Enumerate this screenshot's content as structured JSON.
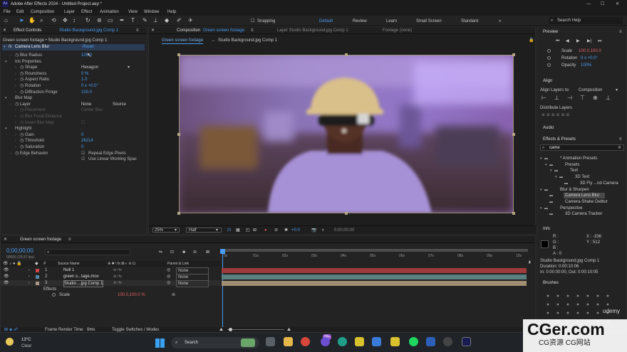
{
  "window": {
    "title": "Adobe After Effects 2024 - Untitled Project.aep *"
  },
  "menu": [
    "File",
    "Edit",
    "Composition",
    "Layer",
    "Effect",
    "Animation",
    "View",
    "Window",
    "Help"
  ],
  "toolbar": {
    "snapping": "Snapping",
    "workspaces": [
      "Default",
      "Review",
      "Learn",
      "Small Screen",
      "Standard"
    ],
    "search": "Search Help"
  },
  "effect_controls": {
    "tab": "Effect Controls",
    "tab_layer": "Studio Background.jpg Comp 1",
    "path": "Green screen footage • Studio Background.jpg Comp 1",
    "effect_name": "Camera Lens Blur",
    "reset": "Reset",
    "props": [
      {
        "name": "Blur Radius",
        "value": "105.0",
        "indent": 1
      },
      {
        "name": "Iris Properties",
        "value": "",
        "indent": 0
      },
      {
        "name": "Shape",
        "value": "Hexagon",
        "indent": 2
      },
      {
        "name": "Roundness",
        "value": "0 %",
        "indent": 2
      },
      {
        "name": "Aspect Ratio",
        "value": "1.0",
        "indent": 2
      },
      {
        "name": "Rotation",
        "value": "0 x +0.0°",
        "indent": 2
      },
      {
        "name": "Diffraction Fringe",
        "value": "100.0",
        "indent": 2
      },
      {
        "name": "Blur Map",
        "value": "",
        "indent": 0
      },
      {
        "name": "Layer",
        "value": "None",
        "value2": "Source",
        "indent": 1
      },
      {
        "name": "Placement",
        "value": "Center Blur",
        "indent": 2,
        "dim": true
      },
      {
        "name": "Blur Focal Distance",
        "value": "",
        "indent": 2,
        "dim": true
      },
      {
        "name": "Invert Blur Map",
        "value": "",
        "indent": 2,
        "dim": true
      },
      {
        "name": "Highlight",
        "value": "",
        "indent": 0
      },
      {
        "name": "Gain",
        "value": "0",
        "indent": 2
      },
      {
        "name": "Threshold",
        "value": "26214",
        "indent": 2
      },
      {
        "name": "Saturation",
        "value": "0",
        "indent": 2
      },
      {
        "name": "Edge Behavior",
        "value": "Repeat Edge Pixels",
        "indent": 1
      },
      {
        "name": "",
        "value": "Use Linear Working Spac",
        "indent": 1
      }
    ]
  },
  "composition": {
    "tab": "Composition",
    "tab_name": "Green screen footage",
    "layer_tab": "Layer Studio Background.jpg Comp 1",
    "footage_tab": "Footage (none)",
    "subtab1": "Green screen footage",
    "subtab2": "Studio Background.jpg Comp 1",
    "zoom": "25%",
    "quality": "Half",
    "exposure": "+0.0",
    "timecode": "0;00;00;00"
  },
  "timeline": {
    "tab": "Green screen footage",
    "timecode": "0;00;00;00",
    "fps": "00000 (29.97 fps)",
    "col_source": "Source Name",
    "col_parent": "Parent & Link",
    "ruler": [
      "0s",
      "01s",
      "02s",
      "03s",
      "04s",
      "05s",
      "06s",
      "07s",
      "08s",
      "09s",
      "10s"
    ],
    "layers": [
      {
        "num": "1",
        "name": "Null 1",
        "parent": "None",
        "color": "#c44",
        "bar": "#a03b3b"
      },
      {
        "num": "2",
        "name": "green s...tage.mov",
        "parent": "None",
        "color": "#58a",
        "bar": "#5a8082"
      },
      {
        "num": "3",
        "name": "Studio ...jpg Comp 1",
        "parent": "None",
        "color": "#a98",
        "bar": "#a28e72"
      }
    ],
    "effects_label": "Effects",
    "scale_label": "Scale",
    "scale_value": "100.0,100.0 %",
    "footer_left": "Frame Render Time:",
    "footer_time": "0ms",
    "footer_toggle": "Toggle Switches / Modes"
  },
  "right": {
    "preview": "Preview",
    "scale_l": "Scale",
    "scale_v": "100.0,100.0",
    "rot_l": "Rotation",
    "rot_v": "0 x +0.0°",
    "opac_l": "Opacity",
    "opac_v": "100%",
    "align": "Align",
    "align_to": "Align Layers to:",
    "align_to_v": "Composition",
    "distribute": "Distribute Layers",
    "audio": "Audio",
    "effects_presets": "Effects & Presets",
    "search_value": "came",
    "tree": [
      {
        "label": "* Animation Presets",
        "indent": 0
      },
      {
        "label": "Presets",
        "indent": 1
      },
      {
        "label": "Text",
        "indent": 2
      },
      {
        "label": "3D Text",
        "indent": 3
      },
      {
        "label": "3D Fly ...nd Camera",
        "indent": 4
      },
      {
        "label": "Blur & Sharpen",
        "indent": 0
      },
      {
        "label": "Camera Lens Blur",
        "indent": 1,
        "selected": true
      },
      {
        "label": "Camera-Shake Deblur",
        "indent": 1
      },
      {
        "label": "Perspective",
        "indent": 0
      },
      {
        "label": "3D Camera Tracker",
        "indent": 1
      }
    ],
    "info": "Info",
    "info_rgb": [
      "R :",
      "G :",
      "B :",
      "A : 0"
    ],
    "info_x": "X : -336",
    "info_y": "Y : 512",
    "info_lines": [
      "Studio Background.jpg Comp 1",
      "Duration: 0:00:10:06",
      "In: 0:00:00:00, Out: 0:00:10:05"
    ],
    "brushes": "Brushes",
    "udemy": "udemy"
  },
  "taskbar": {
    "temp": "13°C",
    "weather": "Clear",
    "search": "Search",
    "badge": "99+"
  },
  "watermark": {
    "main": "CGer.com",
    "sub": "CG资源 CG网站"
  },
  "colors": {
    "accent": "#4a9cf2",
    "bg": "#232323",
    "sky": "#b69ad8",
    "shirt": "#a690d6"
  }
}
